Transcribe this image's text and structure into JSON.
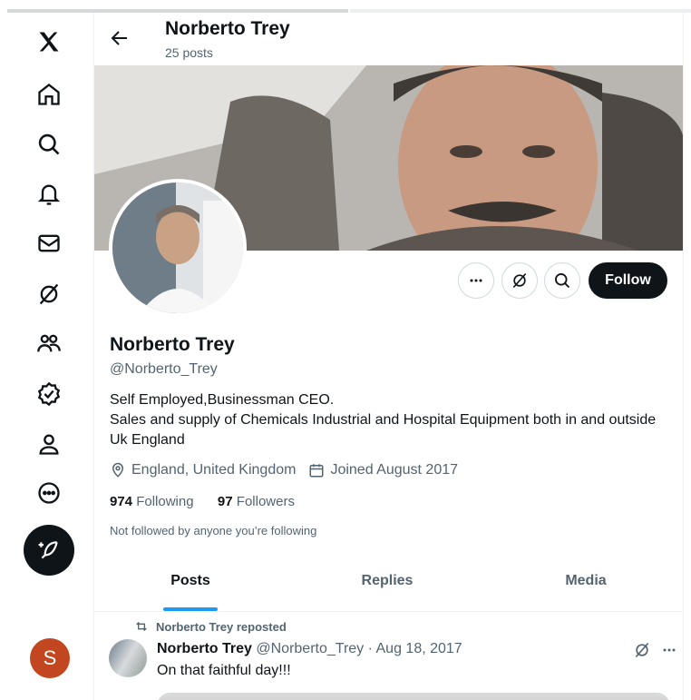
{
  "header": {
    "name": "Norberto Trey",
    "posts_count": "25 posts"
  },
  "profile": {
    "name": "Norberto Trey",
    "handle": "@Norberto_Trey",
    "bio_line1": "Self Employed,Businessman CEO.",
    "bio_line2": "Sales and supply of Chemicals Industrial and Hospital Equipment both in and outside Uk England",
    "location": "England, United Kingdom",
    "joined": "Joined August 2017",
    "following_count": "974",
    "following_label": "Following",
    "followers_count": "97",
    "followers_label": "Followers",
    "not_followed": "Not followed by anyone you’re following"
  },
  "actions": {
    "follow_label": "Follow"
  },
  "tabs": [
    {
      "label": "Posts"
    },
    {
      "label": "Replies"
    },
    {
      "label": "Media"
    }
  ],
  "post": {
    "repost_label": "Norberto Trey reposted",
    "author": "Norberto Trey",
    "handle_date": "@Norberto_Trey · Aug 18, 2017",
    "text": "On that faithful day!!!"
  },
  "user_avatar_letter": "S",
  "icons": [
    "x-logo-icon",
    "home-icon",
    "search-icon",
    "notifications-icon",
    "messages-icon",
    "grok-icon",
    "communities-icon",
    "verified-icon",
    "profile-icon",
    "more-icon",
    "compose-icon"
  ],
  "colors": {
    "accent": "#1d9bf0",
    "text": "#0f1419",
    "secondary": "#536471",
    "user_avatar": "#c2461f"
  }
}
